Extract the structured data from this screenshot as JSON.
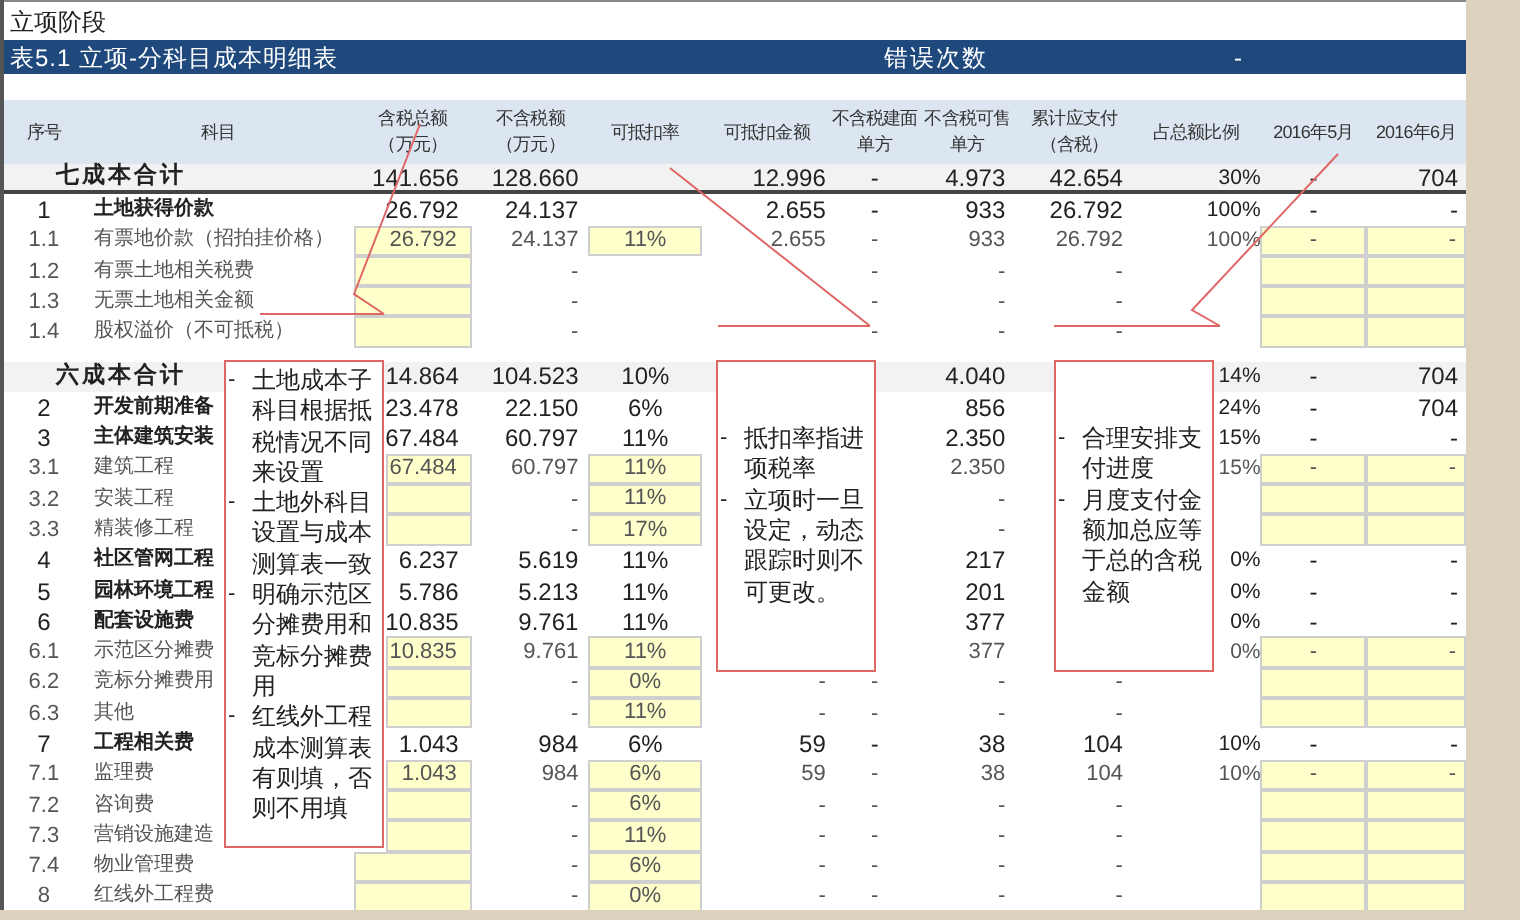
{
  "stage": "立项阶段",
  "title_bar": {
    "title": "表5.1 立项-分科目成本明细表",
    "error_label": "错误次数",
    "error_value": "-"
  },
  "columns": [
    {
      "lines": [
        "序号"
      ]
    },
    {
      "lines": [
        "科目"
      ]
    },
    {
      "lines": [
        "含税总额",
        "（万元）"
      ]
    },
    {
      "lines": [
        "不含税额",
        "（万元）"
      ]
    },
    {
      "lines": [
        "可抵扣率"
      ]
    },
    {
      "lines": [
        "可抵扣金额"
      ]
    },
    {
      "lines": [
        "不含税建面",
        "单方"
      ]
    },
    {
      "lines": [
        "不含税可售",
        "单方"
      ]
    },
    {
      "lines": [
        "累计应支付",
        "（含税）"
      ]
    },
    {
      "lines": [
        "占总额比例"
      ]
    },
    {
      "lines": [
        "2016年5月"
      ]
    },
    {
      "lines": [
        "2016年6月"
      ]
    }
  ],
  "rows": [
    {
      "kind": "total",
      "name": "七成本合计",
      "tax_incl": "141.656",
      "tax_excl": "128.660",
      "deductible": "12.996",
      "built_unit": "-",
      "sale_unit": "4.973",
      "cumulative": "42.654",
      "ratio": "30%",
      "may": "-",
      "june": "704"
    },
    {
      "kind": "group",
      "no": "1",
      "name": "土地获得价款",
      "tax_incl": "26.792",
      "tax_excl": "24.137",
      "deductible": "2.655",
      "built_unit": "-",
      "sale_unit": "933",
      "cumulative": "26.792",
      "ratio": "100%",
      "may": "-",
      "june": "-"
    },
    {
      "kind": "item",
      "no": "1.1",
      "name": "有票地价款（招拍挂价格）",
      "tax_incl": "26.792",
      "tax_excl": "24.137",
      "rate": "11%",
      "deductible": "2.655",
      "built_unit": "-",
      "sale_unit": "933",
      "cumulative": "26.792",
      "ratio": "100%",
      "may": "-",
      "june": "-"
    },
    {
      "kind": "item",
      "no": "1.2",
      "name": "有票土地相关税费",
      "tax_excl": "-",
      "built_unit": "-",
      "sale_unit": "-",
      "cumulative": "-"
    },
    {
      "kind": "item",
      "no": "1.3",
      "name": "无票土地相关金额",
      "tax_excl": "-",
      "built_unit": "-",
      "sale_unit": "-",
      "cumulative": "-"
    },
    {
      "kind": "item",
      "no": "1.4",
      "name": "股权溢价（不可抵税）",
      "tax_excl": "-",
      "built_unit": "-",
      "sale_unit": "-",
      "cumulative": "-"
    },
    {
      "kind": "total",
      "name": "六成本合计",
      "tax_incl": "14.864",
      "tax_excl": "104.523",
      "rate": "10%",
      "sale_unit": "4.040",
      "ratio": "14%",
      "may": "-",
      "june": "704"
    },
    {
      "kind": "group",
      "no": "2",
      "name": "开发前期准备",
      "tax_incl": "23.478",
      "tax_excl": "22.150",
      "rate": "6%",
      "sale_unit": "856",
      "ratio": "24%",
      "may": "-",
      "june": "704"
    },
    {
      "kind": "group",
      "no": "3",
      "name": "主体建筑安装",
      "tax_incl": "67.484",
      "tax_excl": "60.797",
      "rate": "11%",
      "sale_unit": "2.350",
      "ratio": "15%",
      "may": "-",
      "june": "-"
    },
    {
      "kind": "item",
      "no": "3.1",
      "name": "建筑工程",
      "tax_incl": "67.484",
      "tax_excl": "60.797",
      "rate": "11%",
      "sale_unit": "2.350",
      "ratio": "15%",
      "may": "-",
      "june": "-"
    },
    {
      "kind": "item",
      "no": "3.2",
      "name": "安装工程",
      "tax_excl": "-",
      "rate": "11%",
      "sale_unit": "-"
    },
    {
      "kind": "item",
      "no": "3.3",
      "name": "精装修工程",
      "tax_excl": "-",
      "rate": "17%",
      "sale_unit": "-"
    },
    {
      "kind": "group",
      "no": "4",
      "name": "社区管网工程",
      "tax_incl": "6.237",
      "tax_excl": "5.619",
      "rate": "11%",
      "sale_unit": "217",
      "ratio": "0%",
      "may": "-",
      "june": "-"
    },
    {
      "kind": "group",
      "no": "5",
      "name": "园林环境工程",
      "tax_incl": "5.786",
      "tax_excl": "5.213",
      "rate": "11%",
      "sale_unit": "201",
      "ratio": "0%",
      "may": "-",
      "june": "-"
    },
    {
      "kind": "group",
      "no": "6",
      "name": "配套设施费",
      "tax_incl": "10.835",
      "tax_excl": "9.761",
      "rate": "11%",
      "sale_unit": "377",
      "ratio": "0%",
      "may": "-",
      "june": "-"
    },
    {
      "kind": "item",
      "no": "6.1",
      "name": "示范区分摊费",
      "tax_incl": "10.835",
      "tax_excl": "9.761",
      "rate": "11%",
      "sale_unit": "377",
      "ratio": "0%",
      "may": "-",
      "june": "-"
    },
    {
      "kind": "item",
      "no": "6.2",
      "name": "竞标分摊费用",
      "tax_excl": "-",
      "rate": "0%",
      "deductible": "-",
      "built_unit": "-",
      "sale_unit": "-",
      "cumulative": "-"
    },
    {
      "kind": "item",
      "no": "6.3",
      "name": "其他",
      "tax_excl": "-",
      "rate": "11%",
      "deductible": "-",
      "built_unit": "-",
      "sale_unit": "-",
      "cumulative": "-"
    },
    {
      "kind": "group",
      "no": "7",
      "name": "工程相关费",
      "tax_incl": "1.043",
      "tax_excl": "984",
      "rate": "6%",
      "deductible": "59",
      "built_unit": "-",
      "sale_unit": "38",
      "cumulative": "104",
      "ratio": "10%",
      "may": "-",
      "june": "-"
    },
    {
      "kind": "item",
      "no": "7.1",
      "name": "监理费",
      "tax_incl": "1.043",
      "tax_excl": "984",
      "rate": "6%",
      "deductible": "59",
      "built_unit": "-",
      "sale_unit": "38",
      "cumulative": "104",
      "ratio": "10%",
      "may": "-",
      "june": "-"
    },
    {
      "kind": "item",
      "no": "7.2",
      "name": "咨询费",
      "tax_excl": "-",
      "rate": "6%",
      "deductible": "-",
      "built_unit": "-",
      "sale_unit": "-",
      "cumulative": "-"
    },
    {
      "kind": "item",
      "no": "7.3",
      "name": "营销设施建造",
      "tax_excl": "-",
      "rate": "11%",
      "deductible": "-",
      "built_unit": "-",
      "sale_unit": "-",
      "cumulative": "-"
    },
    {
      "kind": "item",
      "no": "7.4",
      "name": "物业管理费",
      "tax_excl": "-",
      "rate": "6%",
      "deductible": "-",
      "built_unit": "-",
      "sale_unit": "-",
      "cumulative": "-"
    },
    {
      "kind": "item",
      "no": "8",
      "name": "红线外工程费",
      "tax_excl": "-",
      "rate": "0%",
      "deductible": "-",
      "built_unit": "-",
      "sale_unit": "-",
      "cumulative": "-"
    }
  ],
  "callouts": [
    {
      "items": [
        {
          "bullet": "-",
          "text": "土地成本子科目根据抵税情况不同来设置"
        },
        {
          "bullet": "-",
          "text": "土地外科目设置与成本测算表一致"
        },
        {
          "bullet": "-",
          "text": "明确示范区分摊费用和竞标分摊费用"
        },
        {
          "bullet": "-",
          "text": "红线外工程成本测算表有则填，否则不用填"
        }
      ]
    },
    {
      "items": [
        {
          "bullet": "-",
          "text": "抵扣率指进项税率"
        },
        {
          "bullet": "-",
          "text": "立项时一旦设定，动态跟踪时则不可更改。"
        }
      ]
    },
    {
      "items": [
        {
          "bullet": "-",
          "text": "合理安排支付进度"
        },
        {
          "bullet": "-",
          "text": "月度支付金额加总应等于总的含税金额"
        }
      ]
    }
  ]
}
